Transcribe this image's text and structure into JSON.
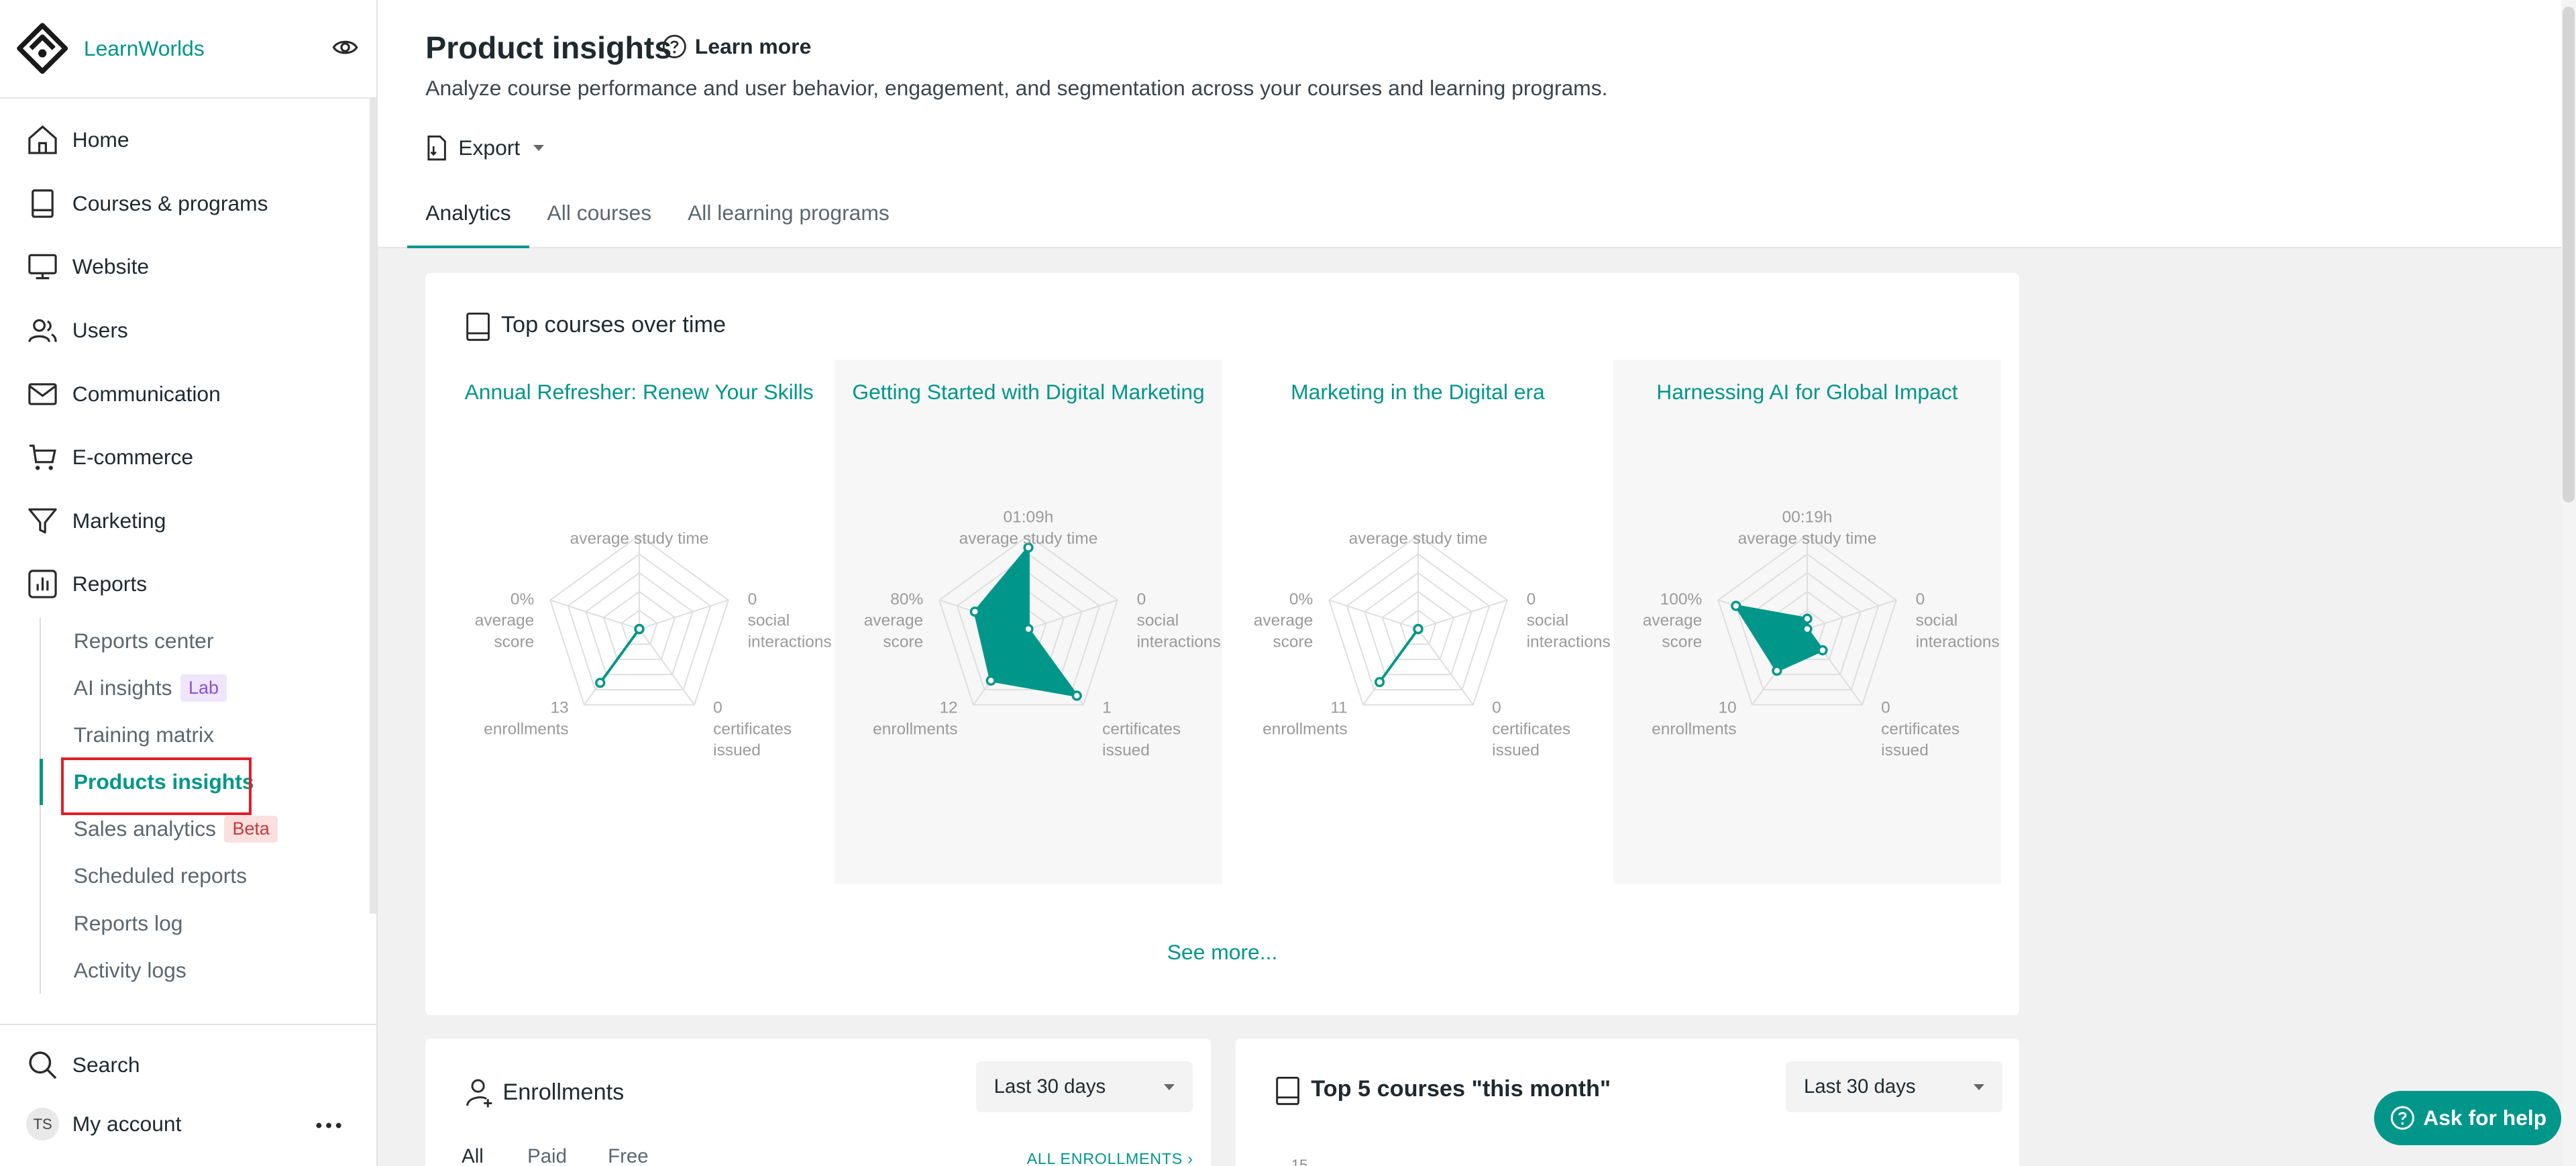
{
  "brand": {
    "name": "LearnWorlds"
  },
  "colors": {
    "accent": "#00968a",
    "highlight_box": "#e01e26"
  },
  "sidebar": {
    "nav": [
      {
        "label": "Home",
        "icon": "home-icon"
      },
      {
        "label": "Courses & programs",
        "icon": "book-icon"
      },
      {
        "label": "Website",
        "icon": "monitor-icon"
      },
      {
        "label": "Users",
        "icon": "users-icon"
      },
      {
        "label": "Communication",
        "icon": "mail-icon"
      },
      {
        "label": "E-commerce",
        "icon": "cart-icon"
      },
      {
        "label": "Marketing",
        "icon": "filter-icon"
      },
      {
        "label": "Reports",
        "icon": "chart-icon"
      }
    ],
    "reports_sub": [
      {
        "label": "Reports center"
      },
      {
        "label": "AI insights",
        "badge": "Lab"
      },
      {
        "label": "Training matrix"
      },
      {
        "label": "Products insights",
        "active": true
      },
      {
        "label": "Sales analytics",
        "badge": "Beta"
      },
      {
        "label": "Scheduled reports"
      },
      {
        "label": "Reports log"
      },
      {
        "label": "Activity logs"
      }
    ],
    "search_label": "Search",
    "account_label": "My account",
    "avatar_initials": "TS"
  },
  "header": {
    "title": "Product insights",
    "learn_more": "Learn more",
    "subtitle": "Analyze course performance and user behavior, engagement, and segmentation across your courses and learning programs.",
    "export_label": "Export",
    "tabs": [
      {
        "label": "Analytics",
        "active": true
      },
      {
        "label": "All courses"
      },
      {
        "label": "All learning programs"
      }
    ]
  },
  "top_courses": {
    "title": "Top courses over time",
    "see_more": "See more...",
    "axes": [
      "average study time",
      "social interactions",
      "certificates issued",
      "enrollments",
      "average score"
    ],
    "courses": [
      {
        "title": "Annual Refresher: Renew Your Skills",
        "study_time": "",
        "social": "0",
        "certificates": "0",
        "enrollments": "13",
        "score": "0%",
        "values": [
          0.0,
          0.0,
          0.0,
          0.71,
          0.0
        ]
      },
      {
        "title": "Getting Started with Digital Marketing",
        "study_time": "01:09h",
        "social": "0",
        "certificates": "1",
        "enrollments": "12",
        "score": "80%",
        "values": [
          0.87,
          0.0,
          0.88,
          0.68,
          0.6
        ]
      },
      {
        "title": "Marketing in the Digital era",
        "study_time": "",
        "social": "0",
        "certificates": "0",
        "enrollments": "11",
        "score": "0%",
        "values": [
          0.0,
          0.0,
          0.0,
          0.7,
          0.0
        ]
      },
      {
        "title": "Harnessing AI for Global Impact",
        "study_time": "00:19h",
        "social": "0",
        "certificates": "0",
        "enrollments": "10",
        "score": "100%",
        "values": [
          0.11,
          0.0,
          0.28,
          0.55,
          0.8
        ]
      }
    ]
  },
  "enrollments": {
    "title": "Enrollments",
    "range": "Last 30 days",
    "tabs": [
      "All",
      "Paid",
      "Free"
    ],
    "link": "ALL ENROLLMENTS"
  },
  "top5": {
    "title": "Top 5 courses \"this month\"",
    "range": "Last 30 days"
  },
  "ask_help": "Ask for help"
}
